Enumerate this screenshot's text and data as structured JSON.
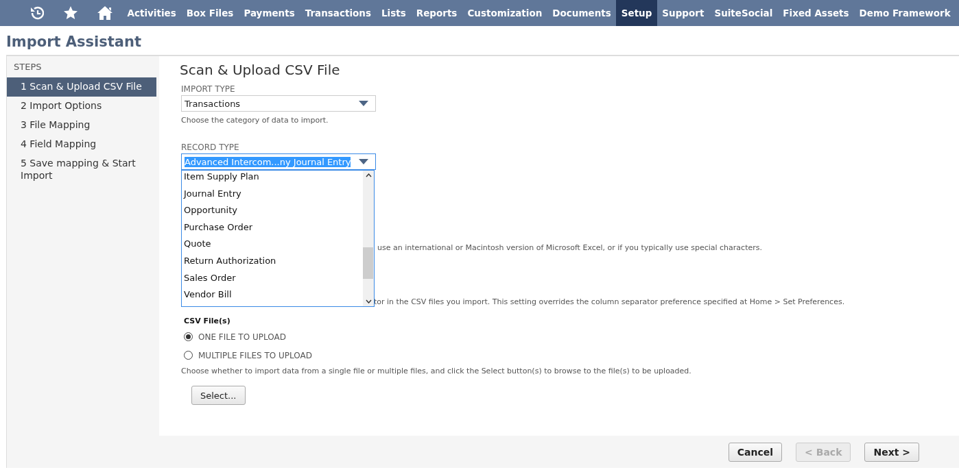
{
  "nav": {
    "items": [
      {
        "label": "Activities",
        "selected": false
      },
      {
        "label": "Box Files",
        "selected": false
      },
      {
        "label": "Payments",
        "selected": false
      },
      {
        "label": "Transactions",
        "selected": false
      },
      {
        "label": "Lists",
        "selected": false
      },
      {
        "label": "Reports",
        "selected": false
      },
      {
        "label": "Customization",
        "selected": false
      },
      {
        "label": "Documents",
        "selected": false
      },
      {
        "label": "Setup",
        "selected": true
      },
      {
        "label": "Support",
        "selected": false
      },
      {
        "label": "SuiteSocial",
        "selected": false
      },
      {
        "label": "Fixed Assets",
        "selected": false
      },
      {
        "label": "Demo Framework",
        "selected": false
      }
    ]
  },
  "page_title": "Import Assistant",
  "steps": {
    "title": "STEPS",
    "items": [
      {
        "label": "1 Scan & Upload CSV File",
        "selected": true
      },
      {
        "label": "2 Import Options",
        "selected": false
      },
      {
        "label": "3 File Mapping",
        "selected": false
      },
      {
        "label": "4 Field Mapping",
        "selected": false
      },
      {
        "label": "5 Save mapping & Start Import",
        "selected": false
      }
    ]
  },
  "form": {
    "heading": "Scan & Upload CSV File",
    "import_type": {
      "label": "IMPORT TYPE",
      "value": "Transactions",
      "help": "Choose the category of data to import."
    },
    "record_type": {
      "label": "RECORD TYPE",
      "value": "Advanced Intercom...ny Journal Entry",
      "expanded": true,
      "options": [
        "Item Supply Plan",
        "Journal Entry",
        "Opportunity",
        "Purchase Order",
        "Quote",
        "Return Authorization",
        "Sales Order",
        "Vendor Bill"
      ]
    },
    "partial_help": [
      "use an international or Macintosh version of Microsoft Excel, or if you typically use special characters.",
      "tor in the CSV files you import. This setting overrides the column separator preference specified at Home > Set Preferences."
    ],
    "csv_files": {
      "label": "CSV File(s)",
      "options": [
        {
          "label": "ONE FILE TO UPLOAD",
          "selected": true
        },
        {
          "label": "MULTIPLE FILES TO UPLOAD",
          "selected": false
        }
      ],
      "help": "Choose whether to import data from a single file or multiple files, and click the Select button(s) to browse to the file(s) to be uploaded.",
      "button": "Select..."
    }
  },
  "footer": {
    "buttons": [
      {
        "label": "Cancel",
        "disabled": false
      },
      {
        "label": "< Back",
        "disabled": true
      },
      {
        "label": "Next >",
        "disabled": false
      }
    ]
  }
}
